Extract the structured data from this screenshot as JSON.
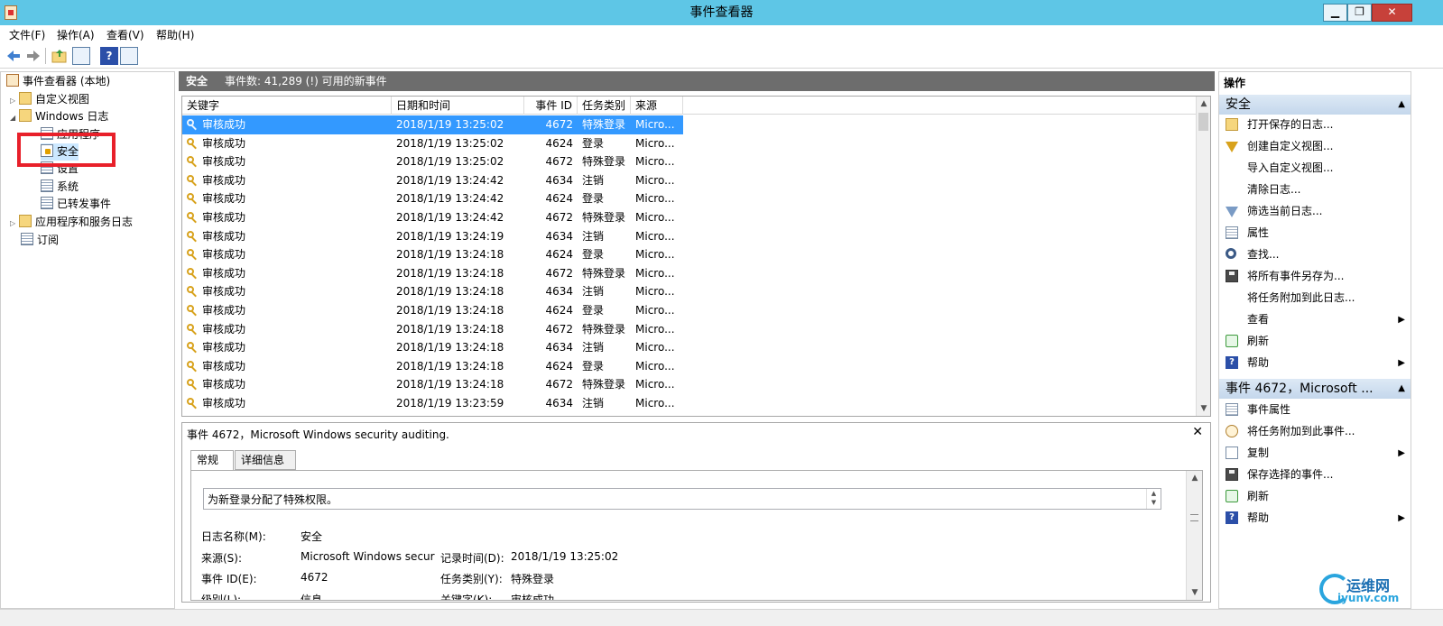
{
  "window": {
    "title": "事件查看器",
    "minimize": "▁",
    "maximize": "❐",
    "close": "✕"
  },
  "menu": [
    "文件(F)",
    "操作(A)",
    "查看(V)",
    "帮助(H)"
  ],
  "tree": {
    "root": "事件查看器 (本地)",
    "custom_views": "自定义视图",
    "windows_logs": "Windows 日志",
    "application": "应用程序",
    "security": "安全",
    "setup": "设置",
    "system": "系统",
    "forwarded": "已转发事件",
    "app_service_logs": "应用程序和服务日志",
    "subscriptions": "订阅"
  },
  "center": {
    "title": "安全",
    "count_text": "事件数: 41,289 (!) 可用的新事件"
  },
  "grid": {
    "columns": [
      "关键字",
      "日期和时间",
      "事件 ID",
      "任务类别",
      "来源"
    ],
    "rows": [
      {
        "keyword": "审核成功",
        "datetime": "2018/1/19 13:25:02",
        "id": "4672",
        "task": "特殊登录",
        "source": "Micro...",
        "selected": true
      },
      {
        "keyword": "审核成功",
        "datetime": "2018/1/19 13:25:02",
        "id": "4624",
        "task": "登录",
        "source": "Micro..."
      },
      {
        "keyword": "审核成功",
        "datetime": "2018/1/19 13:25:02",
        "id": "4672",
        "task": "特殊登录",
        "source": "Micro..."
      },
      {
        "keyword": "审核成功",
        "datetime": "2018/1/19 13:24:42",
        "id": "4634",
        "task": "注销",
        "source": "Micro..."
      },
      {
        "keyword": "审核成功",
        "datetime": "2018/1/19 13:24:42",
        "id": "4624",
        "task": "登录",
        "source": "Micro..."
      },
      {
        "keyword": "审核成功",
        "datetime": "2018/1/19 13:24:42",
        "id": "4672",
        "task": "特殊登录",
        "source": "Micro..."
      },
      {
        "keyword": "审核成功",
        "datetime": "2018/1/19 13:24:19",
        "id": "4634",
        "task": "注销",
        "source": "Micro..."
      },
      {
        "keyword": "审核成功",
        "datetime": "2018/1/19 13:24:18",
        "id": "4624",
        "task": "登录",
        "source": "Micro..."
      },
      {
        "keyword": "审核成功",
        "datetime": "2018/1/19 13:24:18",
        "id": "4672",
        "task": "特殊登录",
        "source": "Micro..."
      },
      {
        "keyword": "审核成功",
        "datetime": "2018/1/19 13:24:18",
        "id": "4634",
        "task": "注销",
        "source": "Micro..."
      },
      {
        "keyword": "审核成功",
        "datetime": "2018/1/19 13:24:18",
        "id": "4624",
        "task": "登录",
        "source": "Micro..."
      },
      {
        "keyword": "审核成功",
        "datetime": "2018/1/19 13:24:18",
        "id": "4672",
        "task": "特殊登录",
        "source": "Micro..."
      },
      {
        "keyword": "审核成功",
        "datetime": "2018/1/19 13:24:18",
        "id": "4634",
        "task": "注销",
        "source": "Micro..."
      },
      {
        "keyword": "审核成功",
        "datetime": "2018/1/19 13:24:18",
        "id": "4624",
        "task": "登录",
        "source": "Micro..."
      },
      {
        "keyword": "审核成功",
        "datetime": "2018/1/19 13:24:18",
        "id": "4672",
        "task": "特殊登录",
        "source": "Micro..."
      },
      {
        "keyword": "审核成功",
        "datetime": "2018/1/19 13:23:59",
        "id": "4634",
        "task": "注销",
        "source": "Micro..."
      },
      {
        "keyword": "审核成功",
        "datetime": "",
        "id": "",
        "task": "",
        "source": ""
      }
    ]
  },
  "details": {
    "title": "事件 4672，Microsoft Windows security auditing.",
    "close": "✕",
    "tabs": [
      "常规",
      "详细信息"
    ],
    "description": "为新登录分配了特殊权限。",
    "log_name_label": "日志名称(M):",
    "log_name_value": "安全",
    "source_label": "来源(S):",
    "source_value": "Microsoft Windows secur",
    "logged_label": "记录时间(D):",
    "logged_value": "2018/1/19 13:25:02",
    "event_id_label": "事件 ID(E):",
    "event_id_value": "4672",
    "task_label": "任务类别(Y):",
    "task_value": "特殊登录",
    "level_label": "级别(L):",
    "level_value": "信息",
    "keywords_label": "关键字(K):",
    "keywords_value": "审核成功"
  },
  "actions": {
    "header": "操作",
    "section1": "安全",
    "items1": [
      {
        "label": "打开保存的日志...",
        "icon": "open"
      },
      {
        "label": "创建自定义视图...",
        "icon": "filter"
      },
      {
        "label": "导入自定义视图...",
        "icon": "none"
      },
      {
        "label": "清除日志...",
        "icon": "none"
      },
      {
        "label": "筛选当前日志...",
        "icon": "filter2"
      },
      {
        "label": "属性",
        "icon": "doc"
      },
      {
        "label": "查找...",
        "icon": "find"
      },
      {
        "label": "将所有事件另存为...",
        "icon": "save"
      },
      {
        "label": "将任务附加到此日志...",
        "icon": "none"
      },
      {
        "label": "查看",
        "icon": "none",
        "submenu": true
      },
      {
        "label": "刷新",
        "icon": "refresh"
      },
      {
        "label": "帮助",
        "icon": "help",
        "submenu": true
      }
    ],
    "section2": "事件 4672，Microsoft ...",
    "items2": [
      {
        "label": "事件属性",
        "icon": "doc"
      },
      {
        "label": "将任务附加到此事件...",
        "icon": "clock"
      },
      {
        "label": "复制",
        "icon": "copy",
        "submenu": true
      },
      {
        "label": "保存选择的事件...",
        "icon": "save"
      },
      {
        "label": "刷新",
        "icon": "refresh"
      },
      {
        "label": "帮助",
        "icon": "help",
        "submenu": true
      }
    ]
  },
  "watermark": {
    "cn": "运维网",
    "en": "iyunv.com"
  }
}
